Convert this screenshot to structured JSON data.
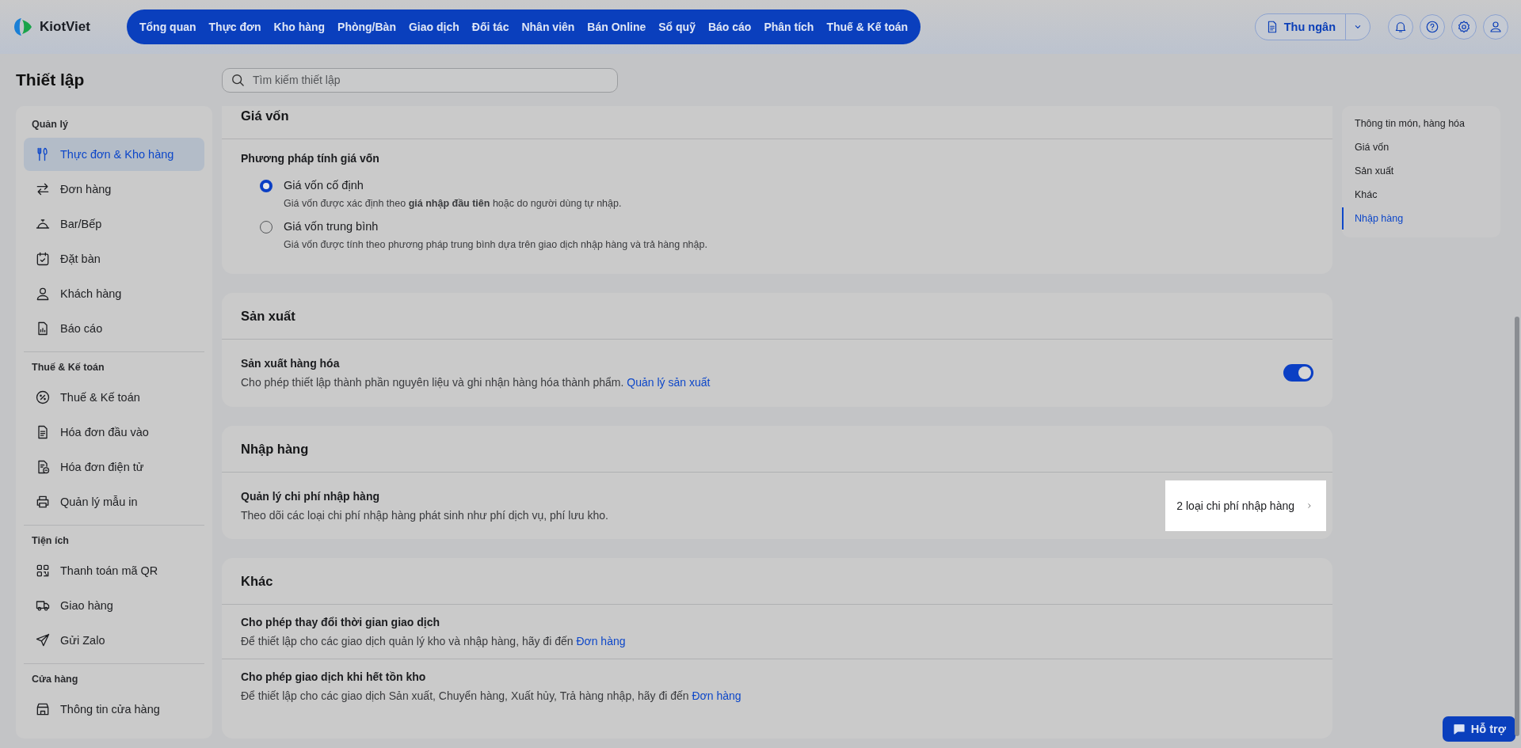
{
  "topbar": {
    "logo_text": "KiotViet",
    "nav_items": [
      {
        "label": "Tổng quan"
      },
      {
        "label": "Thực đơn"
      },
      {
        "label": "Kho hàng"
      },
      {
        "label": "Phòng/Bàn"
      },
      {
        "label": "Giao dịch"
      },
      {
        "label": "Đối tác"
      },
      {
        "label": "Nhân viên"
      },
      {
        "label": "Bán Online"
      },
      {
        "label": "Sổ quỹ"
      },
      {
        "label": "Báo cáo"
      },
      {
        "label": "Phân tích"
      },
      {
        "label": "Thuế & Kế toán"
      }
    ],
    "cashier_button": "Thu ngân"
  },
  "page_title": "Thiết lập",
  "search": {
    "placeholder": "Tìm kiếm thiết lập"
  },
  "sidebar": {
    "sections": [
      {
        "title": "Quản lý",
        "items": [
          {
            "label": "Thực đơn & Kho hàng",
            "selected": true
          },
          {
            "label": "Đơn hàng",
            "selected": false
          },
          {
            "label": "Bar/Bếp",
            "selected": false
          },
          {
            "label": "Đặt bàn",
            "selected": false
          },
          {
            "label": "Khách hàng",
            "selected": false
          },
          {
            "label": "Báo cáo",
            "selected": false
          }
        ]
      },
      {
        "title": "Thuế & Kế toán",
        "items": [
          {
            "label": "Thuế & Kế toán",
            "selected": false
          },
          {
            "label": "Hóa đơn đầu vào",
            "selected": false
          },
          {
            "label": "Hóa đơn điện tử",
            "selected": false
          },
          {
            "label": "Quản lý mẫu in",
            "selected": false
          }
        ]
      },
      {
        "title": "Tiện ích",
        "items": [
          {
            "label": "Thanh toán mã QR",
            "selected": false
          },
          {
            "label": "Giao hàng",
            "selected": false
          },
          {
            "label": "Gửi Zalo",
            "selected": false
          }
        ]
      },
      {
        "title": "Cửa hàng",
        "items": [
          {
            "label": "Thông tin cửa hàng",
            "selected": false
          }
        ]
      }
    ]
  },
  "cards": [
    {
      "title": "Giá vốn",
      "rows": [
        {
          "kind": "radio-group",
          "title": "Phương pháp tính giá vốn",
          "options": [
            {
              "label": "Giá vốn cố định",
              "description": "Giá vốn được xác định theo **giá nhập đầu tiên** hoặc do người dùng tự nhập.",
              "selected": true
            },
            {
              "label": "Giá vốn trung bình",
              "description": "Giá vốn được tính theo phương pháp trung bình dựa trên giao dịch nhập hàng và trả hàng nhập.",
              "selected": false
            }
          ]
        }
      ]
    },
    {
      "title": "Sản xuất",
      "rows": [
        {
          "kind": "toggle",
          "title": "Sản xuất hàng hóa",
          "description": "Cho phép thiết lập thành phần nguyên liệu và ghi nhận hàng hóa thành phẩm.",
          "link": "Quản lý sản xuất",
          "on": true
        }
      ]
    },
    {
      "title": "Nhập hàng",
      "rows": [
        {
          "kind": "value-link",
          "title": "Quản lý chi phí nhập hàng",
          "description": "Theo dõi các loại chi phí nhập hàng phát sinh như phí dịch vụ, phí lưu kho.",
          "value": "2 loại chi phí nhập hàng",
          "highlighted": true
        }
      ]
    },
    {
      "title": "Khác",
      "rows": [
        {
          "kind": "info",
          "title": "Cho phép thay đổi thời gian giao dịch",
          "description": "Để thiết lập cho các giao dịch quản lý kho và nhập hàng, hãy đi đến",
          "link": "Đơn hàng"
        },
        {
          "kind": "info",
          "title": "Cho phép giao dịch khi hết tồn kho",
          "description": "Để thiết lập cho các giao dịch Sản xuất, Chuyển hàng, Xuất hủy, Trả hàng nhập, hãy đi đến",
          "link": "Đơn hàng"
        }
      ]
    }
  ],
  "toc": {
    "items": [
      {
        "label": "Thông tin món, hàng hóa",
        "selected": false
      },
      {
        "label": "Giá vốn",
        "selected": false
      },
      {
        "label": "Sản xuất",
        "selected": false
      },
      {
        "label": "Khác",
        "selected": false
      },
      {
        "label": "Nhập hàng",
        "selected": true
      }
    ]
  },
  "support_button": "Hỗ trợ"
}
